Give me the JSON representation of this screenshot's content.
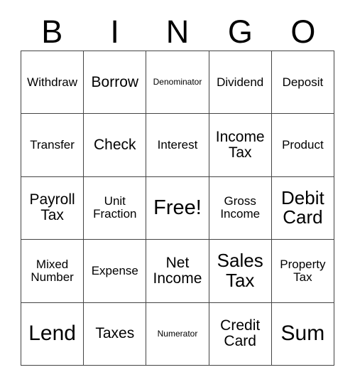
{
  "card": {
    "title_letters": [
      "B",
      "I",
      "N",
      "G",
      "O"
    ],
    "free_space_label": "Free!",
    "colors": {
      "grid_line": "#444444",
      "text": "#000000",
      "background": "#ffffff"
    },
    "rows": [
      [
        {
          "label": "Withdraw",
          "size": "sm"
        },
        {
          "label": "Borrow",
          "size": "md"
        },
        {
          "label": "Denominator",
          "size": "xs"
        },
        {
          "label": "Dividend",
          "size": "sm"
        },
        {
          "label": "Deposit",
          "size": "sm"
        }
      ],
      [
        {
          "label": "Transfer",
          "size": "sm"
        },
        {
          "label": "Check",
          "size": "md"
        },
        {
          "label": "Interest",
          "size": "sm"
        },
        {
          "label": "Income\nTax",
          "size": "md"
        },
        {
          "label": "Product",
          "size": "sm"
        }
      ],
      [
        {
          "label": "Payroll\nTax",
          "size": "md"
        },
        {
          "label": "Unit\nFraction",
          "size": "sm"
        },
        {
          "label": "Free!",
          "size": "free"
        },
        {
          "label": "Gross\nIncome",
          "size": "sm"
        },
        {
          "label": "Debit\nCard",
          "size": "lg"
        }
      ],
      [
        {
          "label": "Mixed\nNumber",
          "size": "sm"
        },
        {
          "label": "Expense",
          "size": "sm"
        },
        {
          "label": "Net\nIncome",
          "size": "md"
        },
        {
          "label": "Sales\nTax",
          "size": "lg"
        },
        {
          "label": "Property\nTax",
          "size": "sm"
        }
      ],
      [
        {
          "label": "Lend",
          "size": "xl"
        },
        {
          "label": "Taxes",
          "size": "md"
        },
        {
          "label": "Numerator",
          "size": "xs"
        },
        {
          "label": "Credit\nCard",
          "size": "md"
        },
        {
          "label": "Sum",
          "size": "xl"
        }
      ]
    ]
  }
}
